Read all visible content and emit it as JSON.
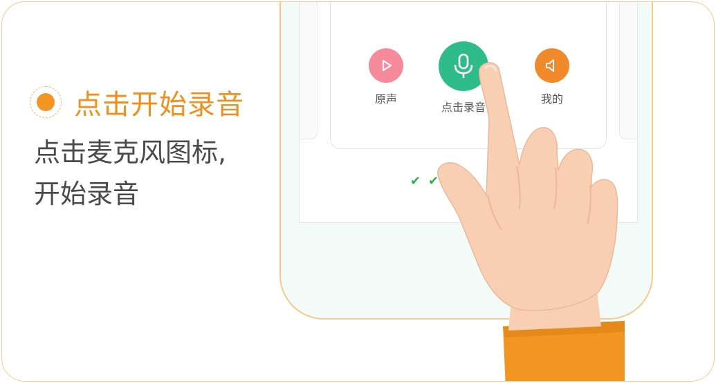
{
  "step": {
    "title": "点击开始录音"
  },
  "description": {
    "line1": "点击麦克风图标,",
    "line2": "开始录音"
  },
  "phone": {
    "buttons": [
      {
        "label": "原声",
        "icon": "play-icon",
        "color": "#f58a9a"
      },
      {
        "label": "点击录音",
        "icon": "microphone-icon",
        "color": "#2ebd8a"
      },
      {
        "label": "我的",
        "icon": "speaker-icon",
        "color": "#f08a2a"
      }
    ],
    "checks": [
      "✔",
      "✔",
      "✔"
    ]
  },
  "colors": {
    "accent": "#f0901c",
    "border": "#f6c98a",
    "sleeve": "#f29522",
    "skin": "#f8cfb2"
  }
}
